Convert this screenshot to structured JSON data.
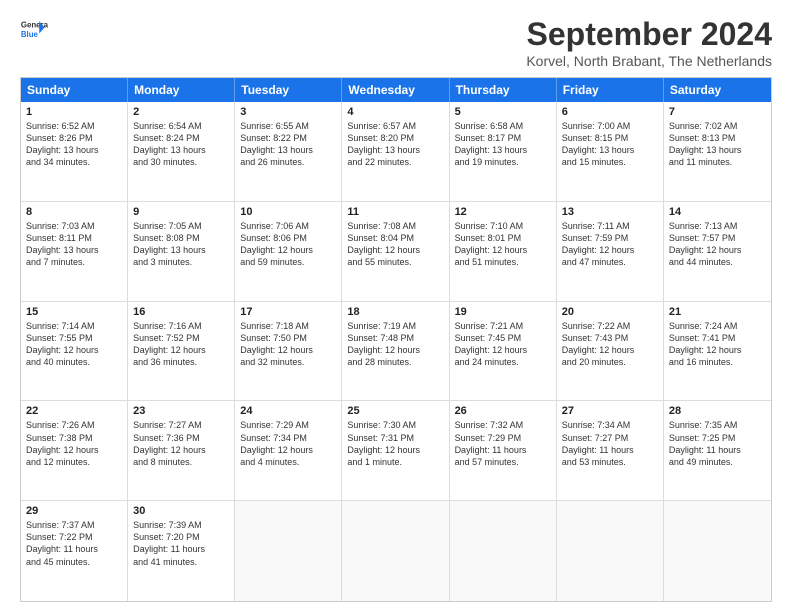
{
  "logo": {
    "line1": "General",
    "line2": "Blue"
  },
  "title": "September 2024",
  "location": "Korvel, North Brabant, The Netherlands",
  "weekdays": [
    "Sunday",
    "Monday",
    "Tuesday",
    "Wednesday",
    "Thursday",
    "Friday",
    "Saturday"
  ],
  "weeks": [
    [
      {
        "day": "1",
        "lines": [
          "Sunrise: 6:52 AM",
          "Sunset: 8:26 PM",
          "Daylight: 13 hours",
          "and 34 minutes."
        ]
      },
      {
        "day": "2",
        "lines": [
          "Sunrise: 6:54 AM",
          "Sunset: 8:24 PM",
          "Daylight: 13 hours",
          "and 30 minutes."
        ]
      },
      {
        "day": "3",
        "lines": [
          "Sunrise: 6:55 AM",
          "Sunset: 8:22 PM",
          "Daylight: 13 hours",
          "and 26 minutes."
        ]
      },
      {
        "day": "4",
        "lines": [
          "Sunrise: 6:57 AM",
          "Sunset: 8:20 PM",
          "Daylight: 13 hours",
          "and 22 minutes."
        ]
      },
      {
        "day": "5",
        "lines": [
          "Sunrise: 6:58 AM",
          "Sunset: 8:17 PM",
          "Daylight: 13 hours",
          "and 19 minutes."
        ]
      },
      {
        "day": "6",
        "lines": [
          "Sunrise: 7:00 AM",
          "Sunset: 8:15 PM",
          "Daylight: 13 hours",
          "and 15 minutes."
        ]
      },
      {
        "day": "7",
        "lines": [
          "Sunrise: 7:02 AM",
          "Sunset: 8:13 PM",
          "Daylight: 13 hours",
          "and 11 minutes."
        ]
      }
    ],
    [
      {
        "day": "8",
        "lines": [
          "Sunrise: 7:03 AM",
          "Sunset: 8:11 PM",
          "Daylight: 13 hours",
          "and 7 minutes."
        ]
      },
      {
        "day": "9",
        "lines": [
          "Sunrise: 7:05 AM",
          "Sunset: 8:08 PM",
          "Daylight: 13 hours",
          "and 3 minutes."
        ]
      },
      {
        "day": "10",
        "lines": [
          "Sunrise: 7:06 AM",
          "Sunset: 8:06 PM",
          "Daylight: 12 hours",
          "and 59 minutes."
        ]
      },
      {
        "day": "11",
        "lines": [
          "Sunrise: 7:08 AM",
          "Sunset: 8:04 PM",
          "Daylight: 12 hours",
          "and 55 minutes."
        ]
      },
      {
        "day": "12",
        "lines": [
          "Sunrise: 7:10 AM",
          "Sunset: 8:01 PM",
          "Daylight: 12 hours",
          "and 51 minutes."
        ]
      },
      {
        "day": "13",
        "lines": [
          "Sunrise: 7:11 AM",
          "Sunset: 7:59 PM",
          "Daylight: 12 hours",
          "and 47 minutes."
        ]
      },
      {
        "day": "14",
        "lines": [
          "Sunrise: 7:13 AM",
          "Sunset: 7:57 PM",
          "Daylight: 12 hours",
          "and 44 minutes."
        ]
      }
    ],
    [
      {
        "day": "15",
        "lines": [
          "Sunrise: 7:14 AM",
          "Sunset: 7:55 PM",
          "Daylight: 12 hours",
          "and 40 minutes."
        ]
      },
      {
        "day": "16",
        "lines": [
          "Sunrise: 7:16 AM",
          "Sunset: 7:52 PM",
          "Daylight: 12 hours",
          "and 36 minutes."
        ]
      },
      {
        "day": "17",
        "lines": [
          "Sunrise: 7:18 AM",
          "Sunset: 7:50 PM",
          "Daylight: 12 hours",
          "and 32 minutes."
        ]
      },
      {
        "day": "18",
        "lines": [
          "Sunrise: 7:19 AM",
          "Sunset: 7:48 PM",
          "Daylight: 12 hours",
          "and 28 minutes."
        ]
      },
      {
        "day": "19",
        "lines": [
          "Sunrise: 7:21 AM",
          "Sunset: 7:45 PM",
          "Daylight: 12 hours",
          "and 24 minutes."
        ]
      },
      {
        "day": "20",
        "lines": [
          "Sunrise: 7:22 AM",
          "Sunset: 7:43 PM",
          "Daylight: 12 hours",
          "and 20 minutes."
        ]
      },
      {
        "day": "21",
        "lines": [
          "Sunrise: 7:24 AM",
          "Sunset: 7:41 PM",
          "Daylight: 12 hours",
          "and 16 minutes."
        ]
      }
    ],
    [
      {
        "day": "22",
        "lines": [
          "Sunrise: 7:26 AM",
          "Sunset: 7:38 PM",
          "Daylight: 12 hours",
          "and 12 minutes."
        ]
      },
      {
        "day": "23",
        "lines": [
          "Sunrise: 7:27 AM",
          "Sunset: 7:36 PM",
          "Daylight: 12 hours",
          "and 8 minutes."
        ]
      },
      {
        "day": "24",
        "lines": [
          "Sunrise: 7:29 AM",
          "Sunset: 7:34 PM",
          "Daylight: 12 hours",
          "and 4 minutes."
        ]
      },
      {
        "day": "25",
        "lines": [
          "Sunrise: 7:30 AM",
          "Sunset: 7:31 PM",
          "Daylight: 12 hours",
          "and 1 minute."
        ]
      },
      {
        "day": "26",
        "lines": [
          "Sunrise: 7:32 AM",
          "Sunset: 7:29 PM",
          "Daylight: 11 hours",
          "and 57 minutes."
        ]
      },
      {
        "day": "27",
        "lines": [
          "Sunrise: 7:34 AM",
          "Sunset: 7:27 PM",
          "Daylight: 11 hours",
          "and 53 minutes."
        ]
      },
      {
        "day": "28",
        "lines": [
          "Sunrise: 7:35 AM",
          "Sunset: 7:25 PM",
          "Daylight: 11 hours",
          "and 49 minutes."
        ]
      }
    ],
    [
      {
        "day": "29",
        "lines": [
          "Sunrise: 7:37 AM",
          "Sunset: 7:22 PM",
          "Daylight: 11 hours",
          "and 45 minutes."
        ]
      },
      {
        "day": "30",
        "lines": [
          "Sunrise: 7:39 AM",
          "Sunset: 7:20 PM",
          "Daylight: 11 hours",
          "and 41 minutes."
        ]
      },
      {
        "day": "",
        "lines": []
      },
      {
        "day": "",
        "lines": []
      },
      {
        "day": "",
        "lines": []
      },
      {
        "day": "",
        "lines": []
      },
      {
        "day": "",
        "lines": []
      }
    ]
  ]
}
